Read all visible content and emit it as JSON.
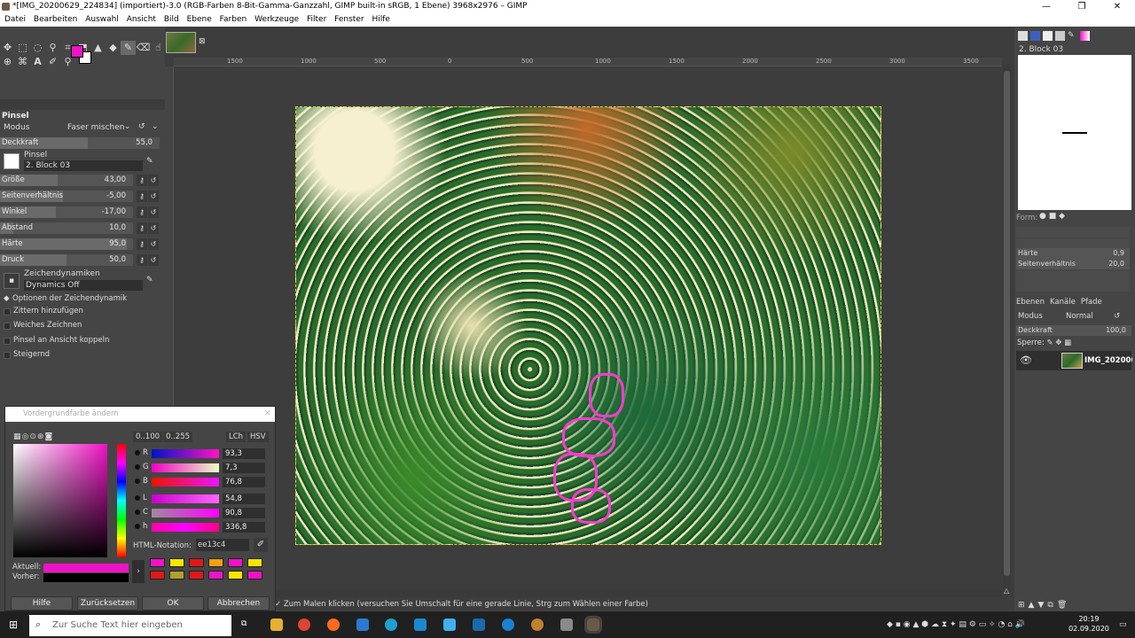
{
  "window": {
    "title": "*[IMG_20200629_224834] (importiert)-3.0 (RGB-Farben 8-Bit-Gamma-Ganzzahl, GIMP built-in sRGB, 1 Ebene) 3968x2976 – GIMP",
    "minimize": "—",
    "maximize": "❐",
    "close": "✕"
  },
  "menu": [
    "Datei",
    "Bearbeiten",
    "Auswahl",
    "Ansicht",
    "Bild",
    "Ebene",
    "Farben",
    "Werkzeuge",
    "Filter",
    "Fenster",
    "Hilfe"
  ],
  "colors": {
    "foreground": "#ee13c4",
    "background": "#ffffff"
  },
  "tool_options": {
    "title": "Pinsel",
    "mode_label": "Modus",
    "mode_value": "Faser mischen",
    "opacity": {
      "label": "Deckkraft",
      "value": "55,0",
      "fraction": 0.55
    },
    "brush_label": "Pinsel",
    "brush_name": "2. Block 03",
    "sliders": [
      {
        "label": "Größe",
        "value": "43,00",
        "fraction": 0.43
      },
      {
        "label": "Seitenverhältnis",
        "value": "-5,00",
        "fraction": 0.47
      },
      {
        "label": "Winkel",
        "value": "-17,00",
        "fraction": 0.42
      },
      {
        "label": "Abstand",
        "value": "10,0",
        "fraction": 0.1
      },
      {
        "label": "Härte",
        "value": "95,0",
        "fraction": 0.95
      },
      {
        "label": "Druck",
        "value": "50,0",
        "fraction": 0.5
      }
    ],
    "dynamics_label": "Zeichendynamiken",
    "dynamics_value": "Dynamics Off",
    "dyn_options": "Optionen der Zeichendynamik",
    "checkboxes": [
      "Zittern hinzufügen",
      "Weiches Zeichnen",
      "Pinsel an Ansicht koppeln",
      "Steigernd"
    ]
  },
  "ruler": {
    "ticks": [
      "1500",
      "1000",
      "500",
      "0",
      "500",
      "1000",
      "1500",
      "2000",
      "2500",
      "3000",
      "3500",
      "4000",
      "4500"
    ]
  },
  "status": "Zum Malen klicken (versuchen Sie Umschalt für eine gerade Linie, Strg zum Wählen einer Farbe)",
  "right_dock": {
    "brush_name": "2. Block 03",
    "form_label": "Form:",
    "params": [
      {
        "label": "Härte",
        "value": "0,9"
      },
      {
        "label": "Seitenverhältnis",
        "value": "20,0"
      }
    ],
    "tabs": [
      "Ebenen",
      "Kanäle",
      "Pfade"
    ],
    "mode_label": "Modus",
    "mode_value": "Normal",
    "opacity_label": "Deckkraft",
    "opacity_value": "100,0",
    "lock_label": "Sperre:",
    "layer_name": "IMG_202006..."
  },
  "color_dialog": {
    "title": "Vordergrundfarbe ändern",
    "range_a": "0..100",
    "range_b": "0..255",
    "lch": "LCh",
    "hsv": "HSV",
    "channels": [
      {
        "name": "R",
        "value": "93,3",
        "grad": "linear-gradient(to right,#0013c4,#ff13c4)"
      },
      {
        "name": "G",
        "value": "7,3",
        "grad": "linear-gradient(to right,#ee00c4,#eeffc4)"
      },
      {
        "name": "B",
        "value": "76,8",
        "grad": "linear-gradient(to right,#ee1300,#ee13ff)"
      },
      {
        "name": "L",
        "value": "54,8",
        "grad": "linear-gradient(to right,#cc00cc,#ff66ff)"
      },
      {
        "name": "C",
        "value": "90,8",
        "grad": "linear-gradient(to right,#a08aa0,#ff00ff)"
      },
      {
        "name": "h",
        "value": "336,8",
        "grad": "linear-gradient(to right,#ff00aa,#ff00ff,#ff0088)"
      }
    ],
    "html_label": "HTML-Notation:",
    "html_value": "ee13c4",
    "current_label": "Aktuell:",
    "previous_label": "Vorher:",
    "current_color": "#ee13c4",
    "previous_color": "#000000",
    "history": [
      "#ee13c4",
      "#f5e500",
      "#e01818",
      "#f0a010",
      "#ee13c4",
      "#f5e500",
      "#e01818",
      "#b0a030",
      "#e01818",
      "#ee13c4",
      "#f5e500",
      "#ee13c4"
    ],
    "buttons": [
      "Hilfe",
      "Zurücksetzen",
      "OK",
      "Abbrechen"
    ]
  },
  "taskbar": {
    "search_placeholder": "Zur Suche Text hier eingeben",
    "time": "20:19",
    "date": "02.09.2020"
  }
}
